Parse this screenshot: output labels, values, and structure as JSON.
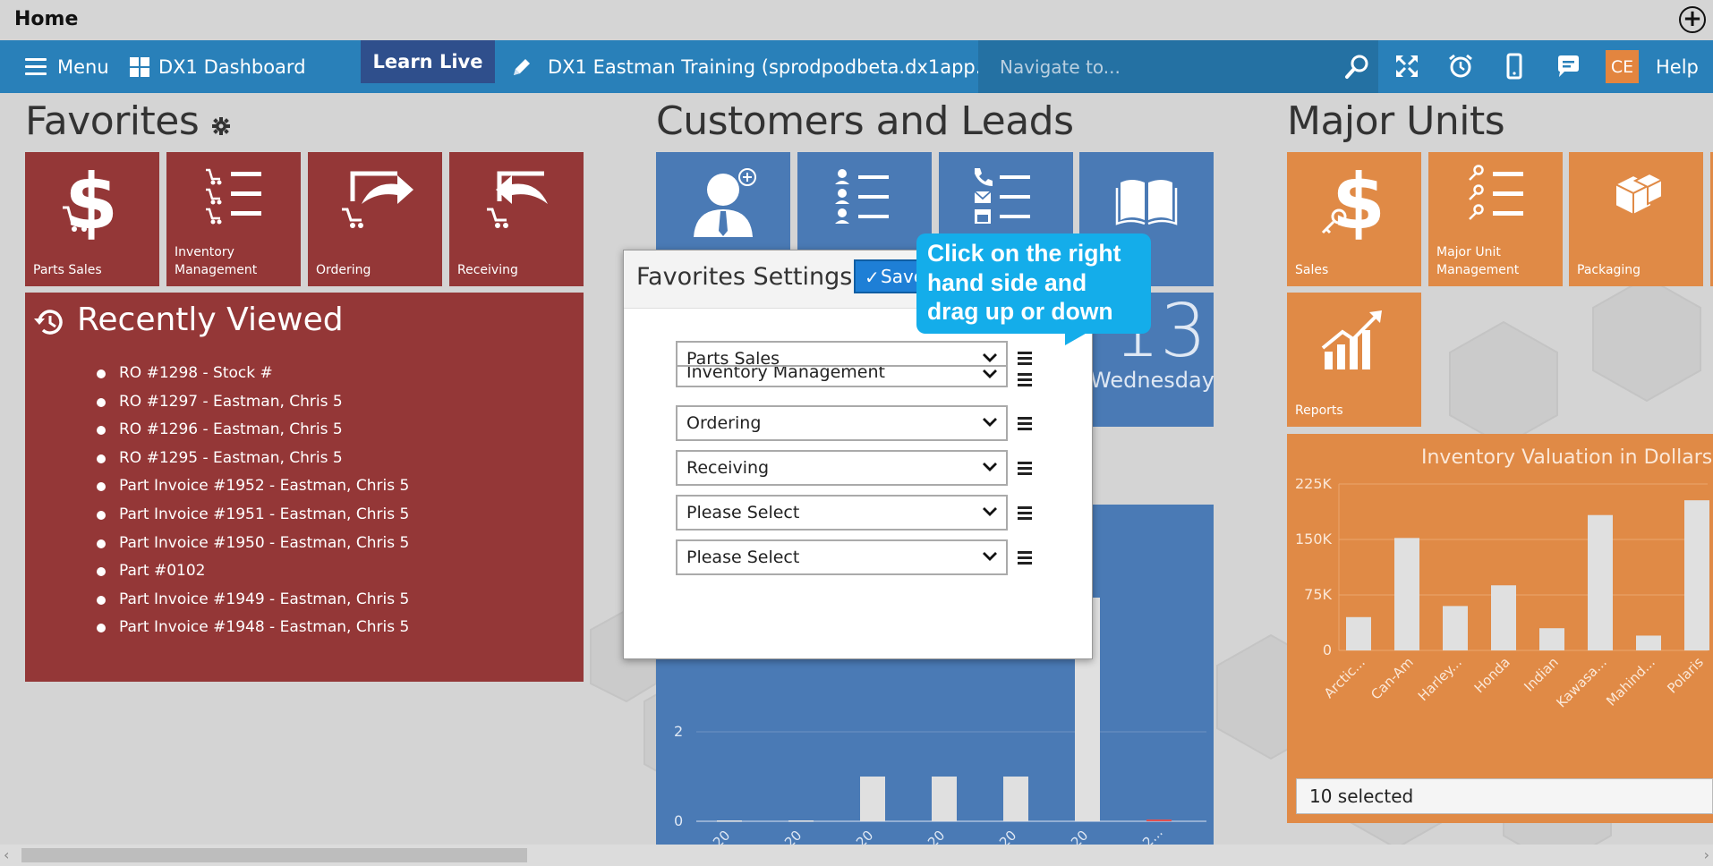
{
  "titlebar": {
    "title": "Home"
  },
  "nav": {
    "menu": "Menu",
    "dashboard": "DX1 Dashboard",
    "learn_live": "Learn Live",
    "training": "DX1 Eastman Training (sprodpodbeta.dx1app.com)",
    "search_placeholder": "Navigate to...",
    "avatar": "CE",
    "help": "Help"
  },
  "favorites": {
    "title": "Favorites",
    "tiles": [
      {
        "label": "Parts Sales"
      },
      {
        "label": "Inventory Management"
      },
      {
        "label": "Ordering"
      },
      {
        "label": "Receiving"
      }
    ]
  },
  "recent": {
    "title": "Recently Viewed",
    "items": [
      "RO #1298 - Stock #",
      "RO #1297 - Eastman, Chris 5",
      "RO #1296 - Eastman, Chris 5",
      "RO #1295 - Eastman, Chris 5",
      "Part Invoice #1952 - Eastman, Chris 5",
      "Part Invoice #1951 - Eastman, Chris 5",
      "Part Invoice #1950 - Eastman, Chris 5",
      "Part #0102",
      "Part Invoice #1949 - Eastman, Chris 5",
      "Part Invoice #1948 - Eastman, Chris 5"
    ]
  },
  "customers": {
    "title": "Customers and Leads",
    "date_number": "13",
    "date_day": "Wednesday",
    "chart_ticks": [
      "2",
      "0"
    ],
    "chart_xlabels": [
      "20",
      "20",
      "20",
      "20",
      "20",
      "20",
      "2..."
    ]
  },
  "major_units": {
    "title": "Major Units",
    "tiles": [
      {
        "label": "Sales"
      },
      {
        "label": "Major Unit Management"
      },
      {
        "label": "Packaging"
      },
      {
        "label": "Reports"
      }
    ],
    "selected": "10 selected"
  },
  "dialog": {
    "title": "Favorites Settings",
    "save_label": "Save",
    "selects": [
      "Parts Sales",
      "Inventory Management",
      "Ordering",
      "Receiving",
      "Please Select",
      "Please Select"
    ]
  },
  "callout": {
    "lines": [
      "Click on the right",
      "hand side and",
      "drag up or down"
    ]
  },
  "chart_data": {
    "type": "bar",
    "title": "Inventory Valuation in Dollars",
    "categories": [
      "Arctic...",
      "Can-Am",
      "Harley...",
      "Honda",
      "Indian",
      "Kawasa...",
      "Mahind...",
      "Polaris"
    ],
    "values": [
      45000,
      152000,
      60000,
      88000,
      30000,
      183000,
      20000,
      203000
    ],
    "ylim": [
      0,
      225000
    ],
    "yticks": [
      "225K",
      "150K",
      "75K",
      "0"
    ],
    "ytick_values": [
      225000,
      150000,
      75000,
      0
    ],
    "colors": {
      "bar": "#e0e0e0",
      "background": "#e08a46"
    }
  }
}
